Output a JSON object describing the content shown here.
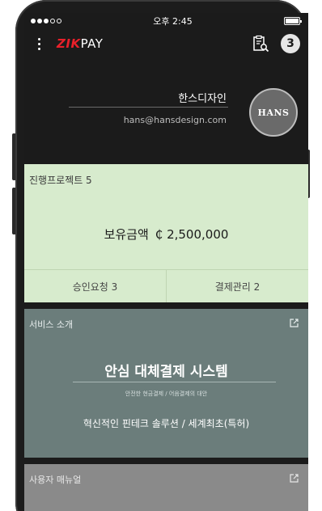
{
  "status_bar": {
    "time": "오후 2:45"
  },
  "app_bar": {
    "logo_brand": "ZIK",
    "logo_suffix": "PAY",
    "notification_count": "3"
  },
  "profile": {
    "name": "한스디자인",
    "email": "hans@hansdesign.com",
    "avatar_text": "HANS"
  },
  "project_card": {
    "title": "진행프로젝트  5",
    "holdings_label": "보유금액",
    "holdings_value": "₵ 2,500,000",
    "approval": "승인요청  3",
    "payment": "결제관리  2"
  },
  "service": {
    "title": "서비스 소개",
    "headline": "안심 대체결제 시스템",
    "subline": "안전한 현금결제 / 어음결제의 대안",
    "tagline": "혁신적인 핀테크 솔루션 / 세계최초(특허)"
  },
  "manual": {
    "title": "사용자 매뉴얼"
  },
  "colors": {
    "brand_red": "#e8202a",
    "dark_bg": "#1b1b1b",
    "project_green": "#d7ebcd",
    "service_teal": "#6b7d7b",
    "manual_gray": "#8a8a8a"
  },
  "icons": [
    "more-vertical-icon",
    "document-search-icon",
    "external-link-icon",
    "battery-icon",
    "signal-icon"
  ]
}
